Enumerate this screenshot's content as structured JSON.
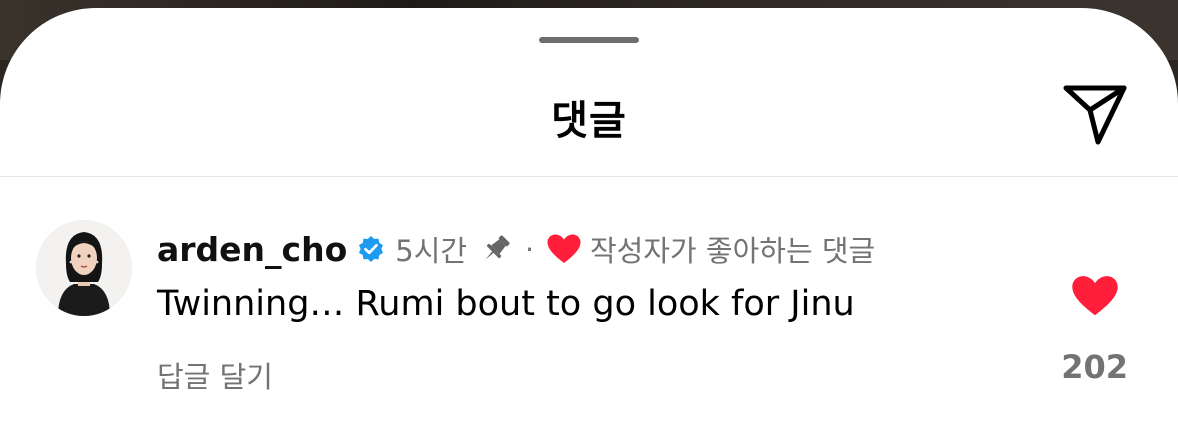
{
  "sheet": {
    "title": "댓글"
  },
  "comment": {
    "username": "arden_cho",
    "time": "5시간",
    "separator": "·",
    "creator_liked": "작성자가 좋아하는 댓글",
    "text": "Twinning… Rumi bout to go look for Jinu",
    "reply_label": "답글 달기",
    "like_count": "202"
  },
  "icons": {
    "share": "paper-plane-icon",
    "verified": "verified-badge-icon",
    "pin": "pushpin-icon",
    "creator_heart": "heart-icon",
    "like": "heart-filled-icon"
  },
  "colors": {
    "accent_red": "#ff1f3a",
    "verified_blue": "#1d9bf0",
    "secondary_text": "#737373"
  }
}
